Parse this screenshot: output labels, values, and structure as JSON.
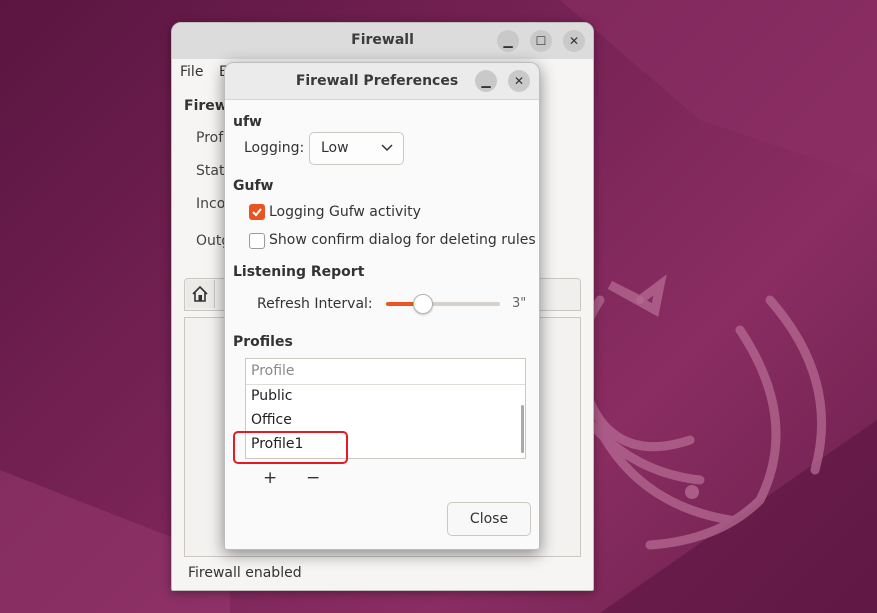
{
  "main_window": {
    "title": "Firewall",
    "menu": [
      "File",
      "E"
    ],
    "section_label": "Firewa",
    "rows": [
      "Prof",
      "Stat",
      "Inco",
      "Outg"
    ],
    "status": "Firewall enabled"
  },
  "preferences": {
    "title": "Firewall Preferences",
    "ufw_title": "ufw",
    "logging_label": "Logging:",
    "logging_value": "Low",
    "gufw_title": "Gufw",
    "logging_gufw_label": "Logging Gufw activity",
    "logging_gufw_checked": true,
    "confirm_label": "Show confirm dialog for deleting rules",
    "confirm_checked": false,
    "listening_title": "Listening Report",
    "refresh_label": "Refresh Interval:",
    "refresh_value": "3\"",
    "refresh_fraction": 0.2,
    "profiles_title": "Profiles",
    "profile_column": "Profile",
    "profiles": [
      "Public",
      "Office",
      "Profile1"
    ],
    "add_label": "+",
    "remove_label": "−",
    "close_label": "Close"
  },
  "colors": {
    "accent": "#e95420",
    "annotation": "#e41b23"
  }
}
